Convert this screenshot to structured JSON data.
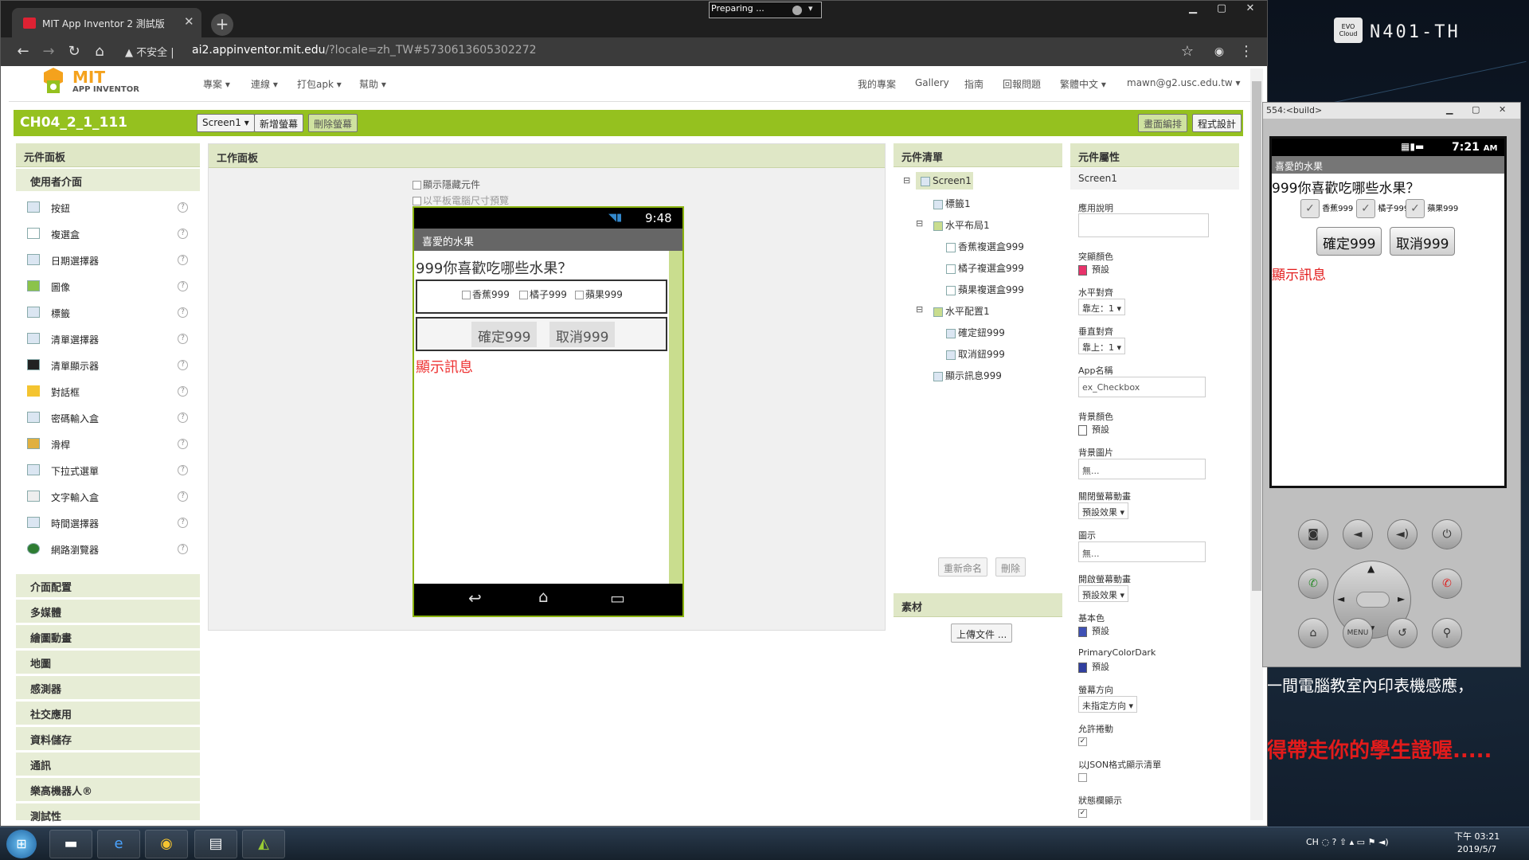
{
  "preparing": "Preparing ...",
  "desktop": {
    "hostname": "N401-TH",
    "notice1": "一間電腦教室內印表機感應，",
    "notice2": "得帶走你的學生證喔....."
  },
  "browser": {
    "tab_title": "MIT App Inventor 2 測試版",
    "security": "不安全",
    "url_host": "ai2.appinventor.mit.edu",
    "url_rest": "/?locale=zh_TW#5730613605302272"
  },
  "header": {
    "logo_mit": "MIT",
    "logo_sub": "APP INVENTOR",
    "menu_left": [
      "專案 ▾",
      "連線 ▾",
      "打包apk ▾",
      "幫助 ▾"
    ],
    "menu_right": [
      "我的專案",
      "Gallery",
      "指南",
      "回報問題",
      "繁體中文 ▾",
      "mawn@g2.usc.edu.tw ▾"
    ]
  },
  "projectbar": {
    "name": "CH04_2_1_111",
    "screen_select": "Screen1 ▾",
    "add_screen": "新增螢幕",
    "remove_screen": "刪除螢幕",
    "designer": "畫面編排",
    "blocks": "程式設計"
  },
  "palette": {
    "title": "元件面板",
    "section": "使用者介面",
    "items": [
      "按鈕",
      "複選盒",
      "日期選擇器",
      "圖像",
      "標籤",
      "清單選擇器",
      "清單顯示器",
      "對話框",
      "密碼輸入盒",
      "滑桿",
      "下拉式選單",
      "文字輸入盒",
      "時間選擇器",
      "網路瀏覽器"
    ],
    "help": "?",
    "categories": [
      "介面配置",
      "多媒體",
      "繪圖動畫",
      "地圖",
      "感測器",
      "社交應用",
      "資料儲存",
      "通訊",
      "樂高機器人®",
      "測試性"
    ]
  },
  "workspace": {
    "title": "工作面板",
    "show_hidden": "顯示隱藏元件",
    "tablet_preview": "以平板電腦尺寸預覽",
    "phone": {
      "time": "9:48",
      "title": "喜愛的水果",
      "question": "999你喜歡吃哪些水果？",
      "checks": [
        "香蕉999",
        "橘子999",
        "蘋果999"
      ],
      "ok": "確定999",
      "cancel": "取消999",
      "msg": "顯示訊息"
    }
  },
  "components": {
    "title": "元件清單",
    "tree": [
      {
        "t": "Screen1"
      },
      {
        "t": "標籤1"
      },
      {
        "t": "水平布局1"
      },
      {
        "t": "香蕉複選盒999"
      },
      {
        "t": "橘子複選盒999"
      },
      {
        "t": "蘋果複選盒999"
      },
      {
        "t": "水平配置1"
      },
      {
        "t": "確定鈕999"
      },
      {
        "t": "取消鈕999"
      },
      {
        "t": "顯示訊息999"
      }
    ],
    "rename": "重新命名",
    "delete": "刪除",
    "media_title": "素材",
    "upload": "上傳文件 ..."
  },
  "properties": {
    "title": "元件屬性",
    "screen": "Screen1",
    "app_desc": "應用說明",
    "accent_label": "突顯顏色",
    "accent_val": "預設",
    "accent_color": "#e8336b",
    "halign_label": "水平對齊",
    "halign_val": "靠左：1 ▾",
    "valign_label": "垂直對齊",
    "valign_val": "靠上：1 ▾",
    "appname_label": "App名稱",
    "appname_val": "ex_Checkbox",
    "bgcolor_label": "背景顏色",
    "bgcolor_val": "預設",
    "bgimg_label": "背景圖片",
    "bgimg_val": "無...",
    "close_anim_label": "關閉螢幕動畫",
    "close_anim_val": "預設效果 ▾",
    "icon_label": "圖示",
    "icon_val": "無...",
    "open_anim_label": "開啟螢幕動畫",
    "open_anim_val": "預設效果 ▾",
    "primary_label": "基本色",
    "primary_val": "預設",
    "primary_color": "#3f51b5",
    "primarydark_label": "PrimaryColorDark",
    "primarydark_val": "預設",
    "primarydark_color": "#303f9f",
    "orient_label": "螢幕方向",
    "orient_val": "未指定方向 ▾",
    "scroll_label": "允許捲動",
    "json_label": "以JSON格式顯示清單",
    "status_label": "狀態欄顯示"
  },
  "emulator": {
    "title": "554:<build>",
    "time": "7:21",
    "ampm": "AM",
    "app_title": "喜愛的水果",
    "question": "999你喜歡吃哪些水果？",
    "checks": [
      "香蕉999",
      "橘子999",
      "蘋果999"
    ],
    "ok": "確定999",
    "cancel": "取消999",
    "msg": "顯示訊息",
    "menu_key": "MENU"
  },
  "taskbar": {
    "tray": "CH",
    "time": "下午 03:21",
    "date": "2019/5/7"
  }
}
